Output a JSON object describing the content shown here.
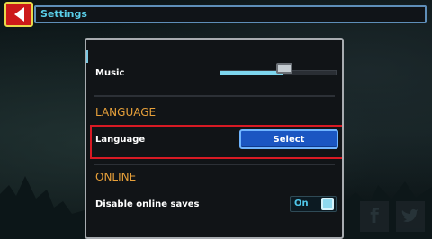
{
  "header": {
    "title": "Settings",
    "back_icon": "back-arrow-icon"
  },
  "audio": {
    "music_label": "Music",
    "music_volume": 0.55
  },
  "language_section": {
    "title": "LANGUAGE",
    "language_label": "Language",
    "select_label": "Select"
  },
  "online_section": {
    "title": "ONLINE",
    "disable_saves_label": "Disable online saves",
    "toggle_value": "On"
  },
  "social": {
    "facebook_icon": "facebook-icon",
    "twitter_icon": "twitter-icon"
  },
  "colors": {
    "accent_cyan": "#5ad0ea",
    "section_orange": "#e7a03a",
    "highlight_red": "#d81a24",
    "button_blue": "#1b56c2"
  }
}
